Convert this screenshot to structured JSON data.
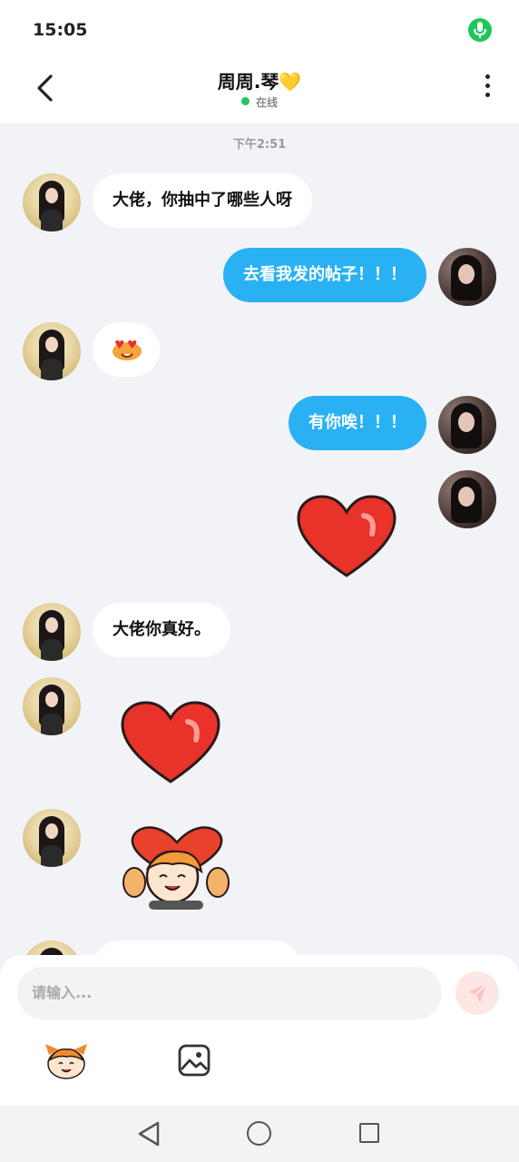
{
  "status_bar": {
    "time": "15:05"
  },
  "header": {
    "title": "周周.琴💛",
    "status": "在线"
  },
  "chat": {
    "timestamp": "下午2:51",
    "messages": [
      {
        "from": "other",
        "type": "text",
        "text": "大佬，你抽中了哪些人呀"
      },
      {
        "from": "me",
        "type": "text",
        "text": "去看我发的帖子！！！"
      },
      {
        "from": "other",
        "type": "sticker",
        "sticker": "heart-eyes-sticker"
      },
      {
        "from": "me",
        "type": "text",
        "text": "有你唉！！！"
      },
      {
        "from": "me",
        "type": "sticker",
        "sticker": "red-heart-sticker"
      },
      {
        "from": "other",
        "type": "text",
        "text": "大佬你真好。"
      },
      {
        "from": "other",
        "type": "sticker",
        "sticker": "red-heart-sticker"
      },
      {
        "from": "other",
        "type": "sticker",
        "sticker": "heart-hug-sticker"
      }
    ]
  },
  "composer": {
    "placeholder": "请输入...",
    "send_icon": "send-icon",
    "emoji_icon": "emoji-sticker-icon",
    "image_icon": "image-icon"
  },
  "colors": {
    "my_bubble": "#29b1f3",
    "their_bubble": "#ffffff",
    "background": "#f2f3f7",
    "online_dot": "#22c55e"
  }
}
